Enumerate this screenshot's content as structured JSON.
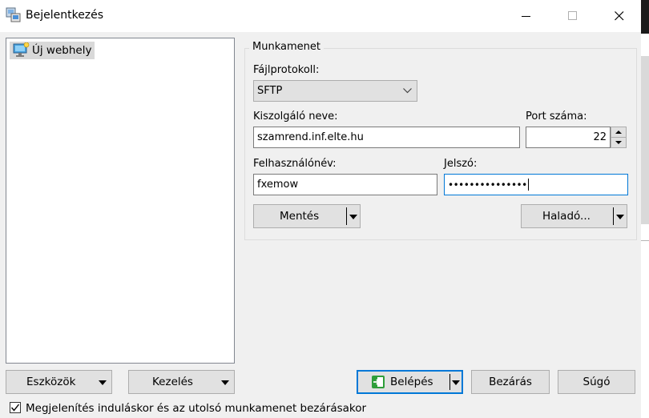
{
  "window": {
    "title": "Bejelentkezés",
    "controls": {
      "minimize": "—",
      "maximize": "☐",
      "close": "✕"
    }
  },
  "tree": {
    "items": [
      {
        "label": "Új webhely"
      }
    ]
  },
  "session": {
    "group_title": "Munkamenet",
    "protocol_label": "Fájlprotokoll:",
    "protocol_value": "SFTP",
    "host_label": "Kiszolgáló neve:",
    "host_value": "szamrend.inf.elte.hu",
    "port_label": "Port száma:",
    "port_value": "22",
    "user_label": "Felhasználónév:",
    "user_value": "fxemow",
    "password_label": "Jelszó:",
    "password_value": "•••••••••••••••",
    "save_button": "Mentés",
    "advanced_button": "Haladó..."
  },
  "bottom": {
    "tools_button": "Eszközök",
    "manage_button": "Kezelés",
    "login_button": "Belépés",
    "close_button": "Bezárás",
    "help_button": "Súgó",
    "checkbox_label": "Megjelenítés induláskor és az utolsó munkamenet bezárásakor",
    "checkbox_checked": true
  },
  "colors": {
    "accent": "#0078d7",
    "login_icon": "#2e9e3a"
  }
}
